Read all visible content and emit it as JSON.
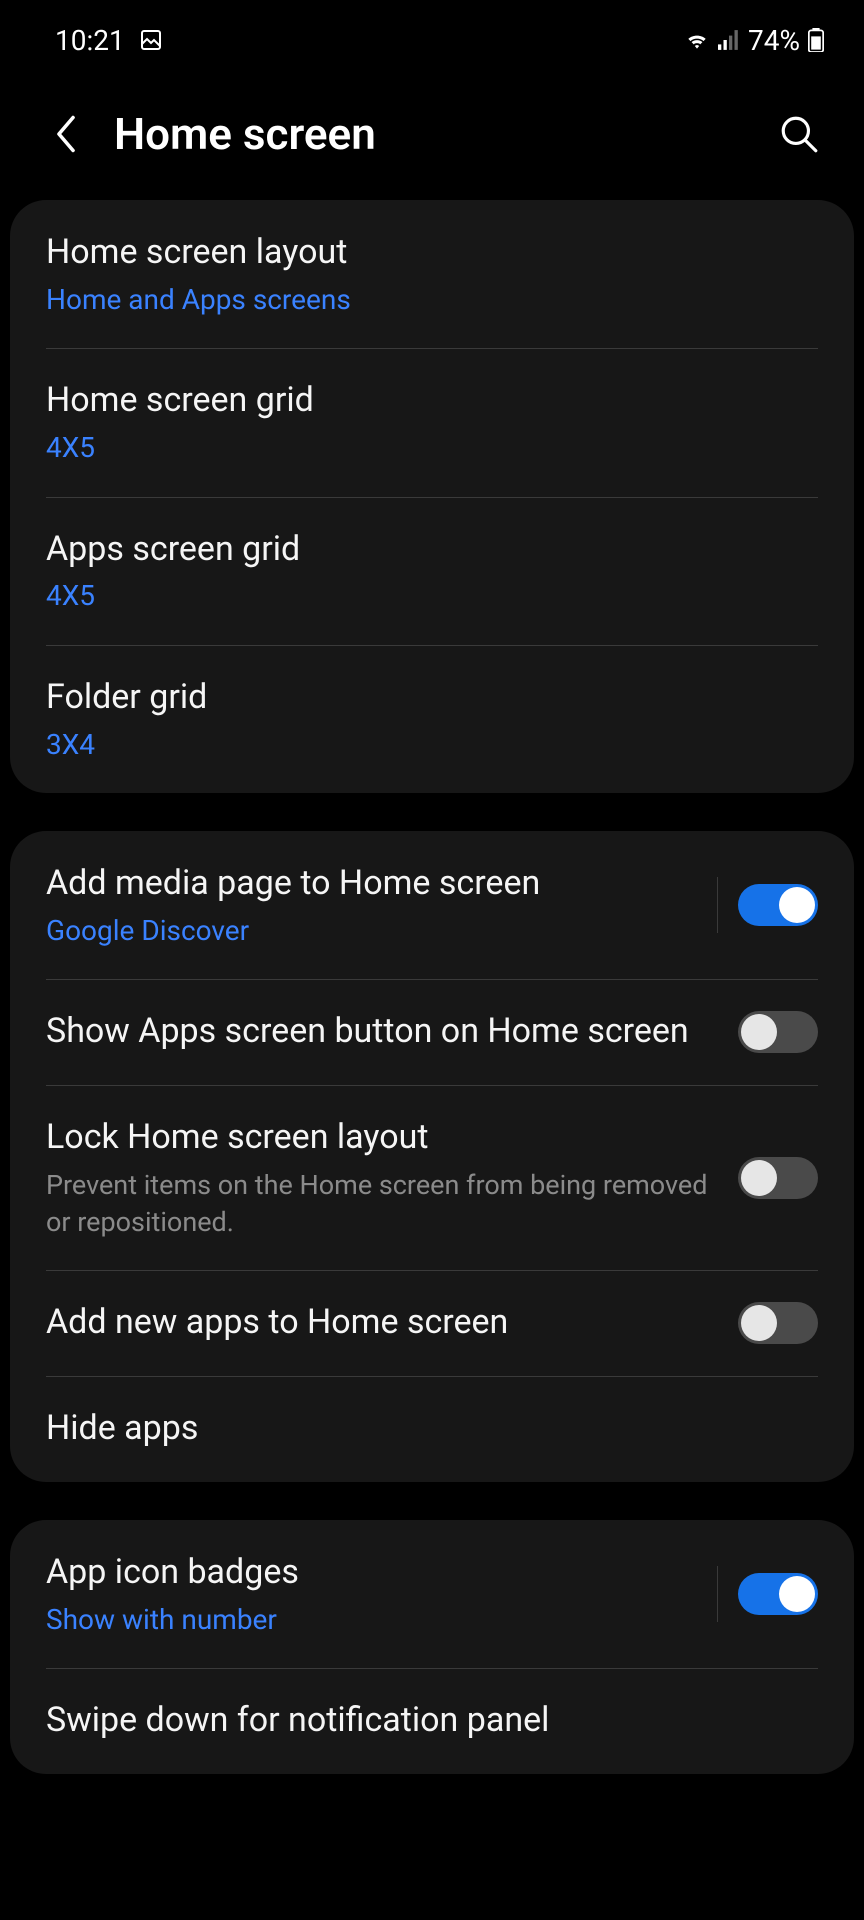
{
  "status": {
    "time": "10:21",
    "battery": "74%"
  },
  "header": {
    "title": "Home screen"
  },
  "g1": {
    "r0_title": "Home screen layout",
    "r0_sub": "Home and Apps screens",
    "r1_title": "Home screen grid",
    "r1_sub": "4X5",
    "r2_title": "Apps screen grid",
    "r2_sub": "4X5",
    "r3_title": "Folder grid",
    "r3_sub": "3X4"
  },
  "g2": {
    "r0_title": "Add media page to Home screen",
    "r0_sub": "Google Discover",
    "r1_title": "Show Apps screen button on Home screen",
    "r2_title": "Lock Home screen layout",
    "r2_sub": "Prevent items on the Home screen from being removed or repositioned.",
    "r3_title": "Add new apps to Home screen",
    "r4_title": "Hide apps"
  },
  "g3": {
    "r0_title": "App icon badges",
    "r0_sub": "Show with number",
    "r1_title": "Swipe down for notification panel"
  }
}
